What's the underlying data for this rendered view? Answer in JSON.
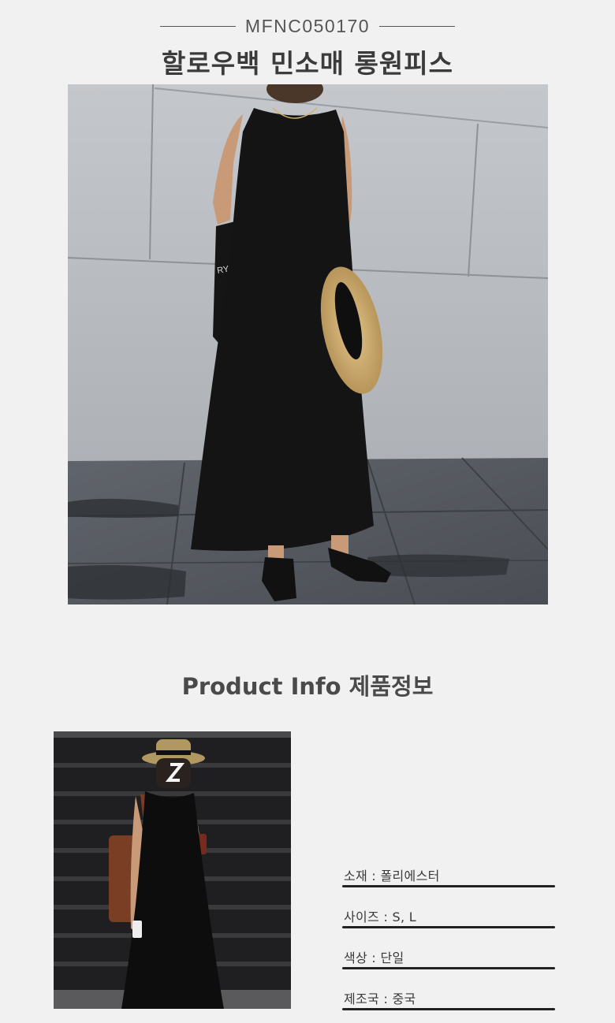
{
  "product": {
    "code": "MFNC050170",
    "name": "할로우백 민소매 롱원피스"
  },
  "sections": {
    "product_info_heading": "Product Info 제품정보"
  },
  "info": [
    {
      "label": "소재 : 폴리에스터"
    },
    {
      "label": "사이즈 : S, L"
    },
    {
      "label": "색상 : 단일"
    },
    {
      "label": "제조국 : 중국"
    }
  ],
  "images": {
    "hero_alt": "black sleeveless long dress model photo",
    "thumb_alt": "model wearing black sleeveless dress with hat"
  },
  "colors": {
    "background": "#f1f1f1",
    "dress": "#141414",
    "wall": "#b9bcc0",
    "floor": "#555a60"
  }
}
